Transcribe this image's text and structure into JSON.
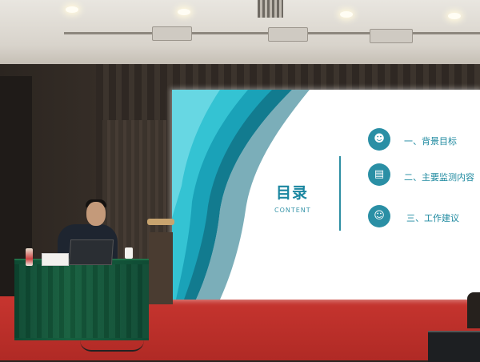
{
  "slide": {
    "title": "目录",
    "subtitle": "CONTENT",
    "items": [
      {
        "icon": "people-group-icon",
        "label": "一、背景目标"
      },
      {
        "icon": "document-list-icon",
        "label": "二、主要监测内容"
      },
      {
        "icon": "person-chat-icon",
        "label": "三、工作建议"
      }
    ]
  },
  "colors": {
    "accent": "#1a86a0",
    "icon_bg": "#2a8fa5",
    "carpet": "#b82e28",
    "table_cloth": "#17603f",
    "wave_light": "#34c3d3",
    "wave_dark": "#127b8f"
  }
}
